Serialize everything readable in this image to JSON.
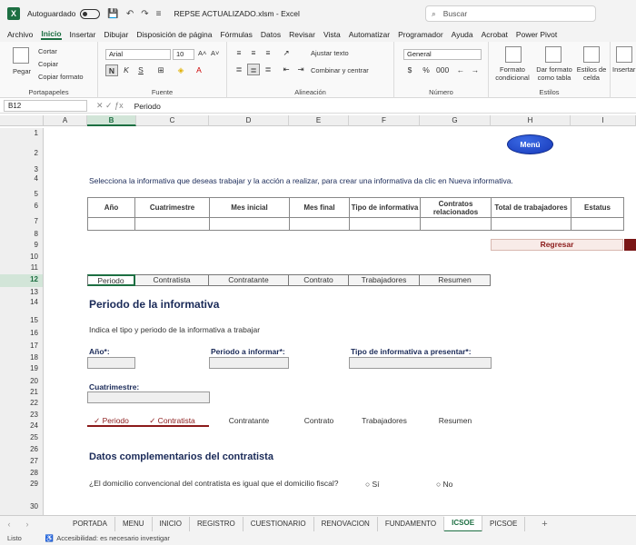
{
  "titlebar": {
    "autosave_label": "Autoguardado",
    "filename": "REPSE ACTUALIZADO.xlsm - Excel",
    "search_placeholder": "Buscar"
  },
  "menu": [
    "Archivo",
    "Inicio",
    "Insertar",
    "Dibujar",
    "Disposición de página",
    "Fórmulas",
    "Datos",
    "Revisar",
    "Vista",
    "Automatizar",
    "Programador",
    "Ayuda",
    "Acrobat",
    "Power Pivot"
  ],
  "menu_active": "Inicio",
  "ribbon": {
    "clipboard": {
      "paste": "Pegar",
      "cut": "Cortar",
      "copy": "Copiar",
      "format_painter": "Copiar formato",
      "label": "Portapapeles"
    },
    "font": {
      "name": "Arial",
      "size": "10",
      "bold": "N",
      "italic": "K",
      "underline": "S",
      "label": "Fuente"
    },
    "alignment": {
      "wrap": "Ajustar texto",
      "merge": "Combinar y centrar",
      "label": "Alineación"
    },
    "number": {
      "format": "General",
      "label": "Número"
    },
    "styles": {
      "cond_format": "Formato condicional",
      "table_format": "Dar formato como tabla",
      "cell_styles": "Estilos de celda",
      "label": "Estilos"
    },
    "cells": {
      "insert": "Insertar"
    }
  },
  "formula_bar": {
    "cell_ref": "B12",
    "content": "Periodo"
  },
  "columns": [
    "A",
    "B",
    "C",
    "D",
    "E",
    "F",
    "G",
    "H",
    "I"
  ],
  "selected_column": "B",
  "rows": [
    "1",
    "2",
    "3",
    "4",
    "5",
    "6",
    "7",
    "8",
    "9",
    "10",
    "11",
    "12",
    "13",
    "14",
    "15",
    "16",
    "17",
    "18",
    "19",
    "20",
    "21",
    "22",
    "23",
    "24",
    "25",
    "26",
    "27",
    "28",
    "29",
    "30"
  ],
  "selected_row": "12",
  "sheet": {
    "menu_button": "Menú",
    "instructions": "Selecciona la informativa que deseas trabajar y la acción a realizar, para crear una informativa da clic en Nueva informativa.",
    "table_headers": [
      "Año",
      "Cuatrimestre",
      "Mes inicial",
      "Mes final",
      "Tipo de informativa",
      "Contratos relacionados",
      "Total de trabajadores",
      "Estatus"
    ],
    "return_button": "Regresar",
    "section_tabs": [
      "Periodo",
      "Contratista",
      "Contratante",
      "Contrato",
      "Trabajadores",
      "Resumen"
    ],
    "section_title": "Periodo de la informativa",
    "section_subtitle": "Indica el tipo y periodo de la informativa a trabajar",
    "year_label": "Año*:",
    "period_label": "Periodo a informar*:",
    "type_label": "Tipo de informativa a presentar*:",
    "cuatrimestre_label": "Cuatrimestre:",
    "progress_tabs": [
      "✓ Periodo",
      "✓ Contratista",
      "Contratante",
      "Contrato",
      "Trabajadores",
      "Resumen"
    ],
    "complement_title": "Datos complementarios del contratista",
    "question": "¿El domicilio convencional del contratista es igual que el domicilio fiscal?",
    "option_yes": "Sí",
    "option_no": "No"
  },
  "sheet_tabs": [
    "PORTADA",
    "MENU",
    "INICIO",
    "REGISTRO",
    "CUESTIONARIO",
    "RENOVACION",
    "FUNDAMENTO",
    "ICSOE",
    "PICSOE"
  ],
  "active_sheet": "ICSOE",
  "status": {
    "ready": "Listo",
    "accessibility": "Accesibilidad: es necesario investigar"
  }
}
